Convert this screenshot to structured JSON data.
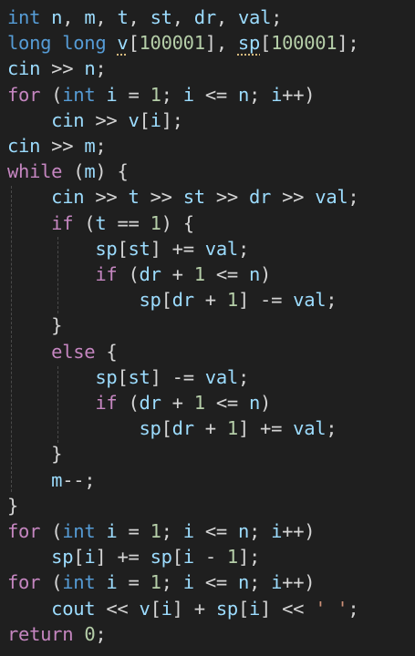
{
  "code": {
    "lines": [
      [
        [
          "kw",
          "int"
        ],
        [
          "var",
          " n"
        ],
        [
          "pun",
          ", "
        ],
        [
          "var",
          "m"
        ],
        [
          "pun",
          ", "
        ],
        [
          "var",
          "t"
        ],
        [
          "pun",
          ", "
        ],
        [
          "var",
          "st"
        ],
        [
          "pun",
          ", "
        ],
        [
          "var",
          "dr"
        ],
        [
          "pun",
          ", "
        ],
        [
          "var",
          "val"
        ],
        [
          "pun",
          ";"
        ]
      ],
      [
        [
          "kw",
          "long long "
        ],
        [
          "sq",
          "v"
        ],
        [
          "pun",
          "["
        ],
        [
          "num",
          "100001"
        ],
        [
          "pun",
          "], "
        ],
        [
          "sq",
          "sp"
        ],
        [
          "pun",
          "["
        ],
        [
          "num",
          "100001"
        ],
        [
          "pun",
          "];"
        ]
      ],
      [
        [
          "var",
          "cin "
        ],
        [
          "pun",
          ">> "
        ],
        [
          "var",
          "n"
        ],
        [
          "pun",
          ";"
        ]
      ],
      [
        [
          "ctl",
          "for"
        ],
        [
          "pun",
          " ("
        ],
        [
          "kw",
          "int"
        ],
        [
          "var",
          " i "
        ],
        [
          "pun",
          "= "
        ],
        [
          "num",
          "1"
        ],
        [
          "pun",
          "; "
        ],
        [
          "var",
          "i "
        ],
        [
          "pun",
          "<= "
        ],
        [
          "var",
          "n"
        ],
        [
          "pun",
          "; "
        ],
        [
          "var",
          "i"
        ],
        [
          "pun",
          "++)"
        ]
      ],
      [
        [
          "pun",
          "    "
        ],
        [
          "var",
          "cin "
        ],
        [
          "pun",
          ">> "
        ],
        [
          "var",
          "v"
        ],
        [
          "pun",
          "["
        ],
        [
          "var",
          "i"
        ],
        [
          "pun",
          "];"
        ]
      ],
      [
        [
          "var",
          "cin "
        ],
        [
          "pun",
          ">> "
        ],
        [
          "var",
          "m"
        ],
        [
          "pun",
          ";"
        ]
      ],
      [
        [
          "ctl",
          "while"
        ],
        [
          "pun",
          " ("
        ],
        [
          "var",
          "m"
        ],
        [
          "pun",
          ") {"
        ]
      ],
      [
        [
          "pun",
          "    "
        ],
        [
          "var",
          "cin "
        ],
        [
          "pun",
          ">> "
        ],
        [
          "var",
          "t "
        ],
        [
          "pun",
          ">> "
        ],
        [
          "var",
          "st "
        ],
        [
          "pun",
          ">> "
        ],
        [
          "var",
          "dr "
        ],
        [
          "pun",
          ">> "
        ],
        [
          "var",
          "val"
        ],
        [
          "pun",
          ";"
        ]
      ],
      [
        [
          "pun",
          "    "
        ],
        [
          "ctl",
          "if"
        ],
        [
          "pun",
          " ("
        ],
        [
          "var",
          "t "
        ],
        [
          "pun",
          "== "
        ],
        [
          "num",
          "1"
        ],
        [
          "pun",
          ") {"
        ]
      ],
      [
        [
          "pun",
          "        "
        ],
        [
          "var",
          "sp"
        ],
        [
          "pun",
          "["
        ],
        [
          "var",
          "st"
        ],
        [
          "pun",
          "] += "
        ],
        [
          "var",
          "val"
        ],
        [
          "pun",
          ";"
        ]
      ],
      [
        [
          "pun",
          "        "
        ],
        [
          "ctl",
          "if"
        ],
        [
          "pun",
          " ("
        ],
        [
          "var",
          "dr "
        ],
        [
          "pun",
          "+ "
        ],
        [
          "num",
          "1"
        ],
        [
          "pun",
          " <= "
        ],
        [
          "var",
          "n"
        ],
        [
          "pun",
          ")"
        ]
      ],
      [
        [
          "pun",
          "            "
        ],
        [
          "var",
          "sp"
        ],
        [
          "pun",
          "["
        ],
        [
          "var",
          "dr "
        ],
        [
          "pun",
          "+ "
        ],
        [
          "num",
          "1"
        ],
        [
          "pun",
          "] -= "
        ],
        [
          "var",
          "val"
        ],
        [
          "pun",
          ";"
        ]
      ],
      [
        [
          "pun",
          "    }"
        ]
      ],
      [
        [
          "pun",
          "    "
        ],
        [
          "ctl",
          "else"
        ],
        [
          "pun",
          " {"
        ]
      ],
      [
        [
          "pun",
          "        "
        ],
        [
          "var",
          "sp"
        ],
        [
          "pun",
          "["
        ],
        [
          "var",
          "st"
        ],
        [
          "pun",
          "] -= "
        ],
        [
          "var",
          "val"
        ],
        [
          "pun",
          ";"
        ]
      ],
      [
        [
          "pun",
          "        "
        ],
        [
          "ctl",
          "if"
        ],
        [
          "pun",
          " ("
        ],
        [
          "var",
          "dr "
        ],
        [
          "pun",
          "+ "
        ],
        [
          "num",
          "1"
        ],
        [
          "pun",
          " <= "
        ],
        [
          "var",
          "n"
        ],
        [
          "pun",
          ")"
        ]
      ],
      [
        [
          "pun",
          "            "
        ],
        [
          "var",
          "sp"
        ],
        [
          "pun",
          "["
        ],
        [
          "var",
          "dr "
        ],
        [
          "pun",
          "+ "
        ],
        [
          "num",
          "1"
        ],
        [
          "pun",
          "] += "
        ],
        [
          "var",
          "val"
        ],
        [
          "pun",
          ";"
        ]
      ],
      [
        [
          "pun",
          "    }"
        ]
      ],
      [
        [
          "pun",
          "    "
        ],
        [
          "var",
          "m"
        ],
        [
          "pun",
          "--;"
        ]
      ],
      [
        [
          "pun",
          "}"
        ]
      ],
      [
        [
          "ctl",
          "for"
        ],
        [
          "pun",
          " ("
        ],
        [
          "kw",
          "int"
        ],
        [
          "var",
          " i "
        ],
        [
          "pun",
          "= "
        ],
        [
          "num",
          "1"
        ],
        [
          "pun",
          "; "
        ],
        [
          "var",
          "i "
        ],
        [
          "pun",
          "<= "
        ],
        [
          "var",
          "n"
        ],
        [
          "pun",
          "; "
        ],
        [
          "var",
          "i"
        ],
        [
          "pun",
          "++)"
        ]
      ],
      [
        [
          "pun",
          "    "
        ],
        [
          "var",
          "sp"
        ],
        [
          "pun",
          "["
        ],
        [
          "var",
          "i"
        ],
        [
          "pun",
          "] += "
        ],
        [
          "var",
          "sp"
        ],
        [
          "pun",
          "["
        ],
        [
          "var",
          "i "
        ],
        [
          "pun",
          "- "
        ],
        [
          "num",
          "1"
        ],
        [
          "pun",
          "];"
        ]
      ],
      [
        [
          "ctl",
          "for"
        ],
        [
          "pun",
          " ("
        ],
        [
          "kw",
          "int"
        ],
        [
          "var",
          " i "
        ],
        [
          "pun",
          "= "
        ],
        [
          "num",
          "1"
        ],
        [
          "pun",
          "; "
        ],
        [
          "var",
          "i "
        ],
        [
          "pun",
          "<= "
        ],
        [
          "var",
          "n"
        ],
        [
          "pun",
          "; "
        ],
        [
          "var",
          "i"
        ],
        [
          "pun",
          "++)"
        ]
      ],
      [
        [
          "pun",
          "    "
        ],
        [
          "var",
          "cout "
        ],
        [
          "pun",
          "<< "
        ],
        [
          "var",
          "v"
        ],
        [
          "pun",
          "["
        ],
        [
          "var",
          "i"
        ],
        [
          "pun",
          "] + "
        ],
        [
          "var",
          "sp"
        ],
        [
          "pun",
          "["
        ],
        [
          "var",
          "i"
        ],
        [
          "pun",
          "] << "
        ],
        [
          "str",
          "' '"
        ],
        [
          "pun",
          ";"
        ]
      ],
      [
        [
          "ctl",
          "return"
        ],
        [
          "pun",
          " "
        ],
        [
          "num",
          "0"
        ],
        [
          "pun",
          ";"
        ]
      ]
    ]
  }
}
